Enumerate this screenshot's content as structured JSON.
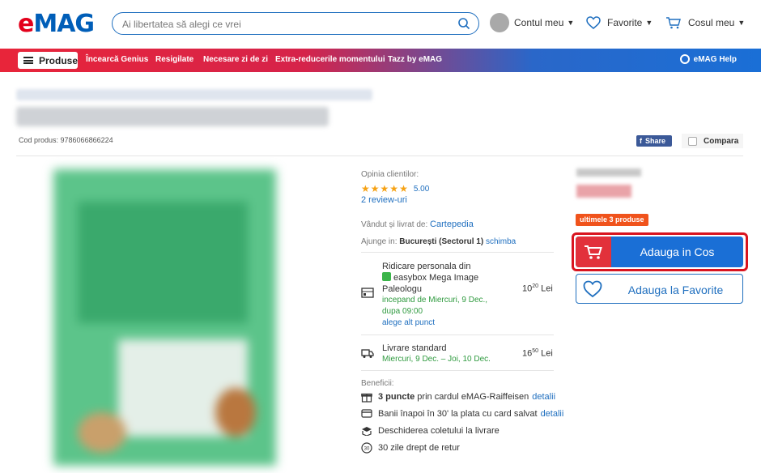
{
  "header": {
    "logo": "eMAG",
    "search_placeholder": "Ai libertatea să alegi ce vrei",
    "account": "Contul meu",
    "favorites": "Favorite",
    "cart": "Cosul meu"
  },
  "nav": {
    "products": "Produse",
    "items": [
      "Încearcă Genius",
      "Resigilate",
      "Necesare zi de zi",
      "Extra-reducerile momentului",
      "Tazz by eMAG"
    ],
    "help": "eMAG Help"
  },
  "product": {
    "code_label": "Cod produs: 9786066866224",
    "share": "Share",
    "compare": "Compara"
  },
  "reviews": {
    "label": "Opinia clientilor:",
    "rating": "5.00",
    "count": "2 review-uri",
    "stars": 5
  },
  "seller": {
    "label": "Vândut și livrat de:",
    "name": "Cartepedia"
  },
  "location": {
    "label": "Ajunge in:",
    "place": "București (Sectorul 1)",
    "change": "schimba"
  },
  "delivery": {
    "pickup_line1": "Ridicare personala din",
    "pickup_line2": "easybox Mega Image",
    "pickup_line3": "Paleologu",
    "pickup_when1": "incepand de Miercuri, 9 Dec.,",
    "pickup_when2": "dupa 09:00",
    "pickup_alt": "alege alt punct",
    "pickup_price_int": "10",
    "pickup_price_dec": "20",
    "currency": "Lei",
    "standard_label": "Livrare standard",
    "standard_when": "Miercuri, 9 Dec. – Joi, 10 Dec.",
    "standard_price_int": "16",
    "standard_price_dec": "50"
  },
  "benefits": {
    "label": "Beneficii:",
    "points_bold": "3 puncte",
    "points_text": "prin cardul eMAG-Raiffeisen",
    "points_link": "detalii",
    "refund_text": "Banii înapoi în 30' la plata cu card salvat",
    "refund_link": "detalii",
    "open_text": "Deschiderea coletului la livrare",
    "return_text": "30 zile drept de retur",
    "return_num": "30"
  },
  "buy": {
    "badge": "ultimele 3 produse",
    "add_cart": "Adauga in Cos",
    "add_fav": "Adauga la Favorite"
  },
  "colors": {
    "brand_red": "#e3001b",
    "brand_blue": "#1a6fd6",
    "highlight": "#d9141f"
  }
}
